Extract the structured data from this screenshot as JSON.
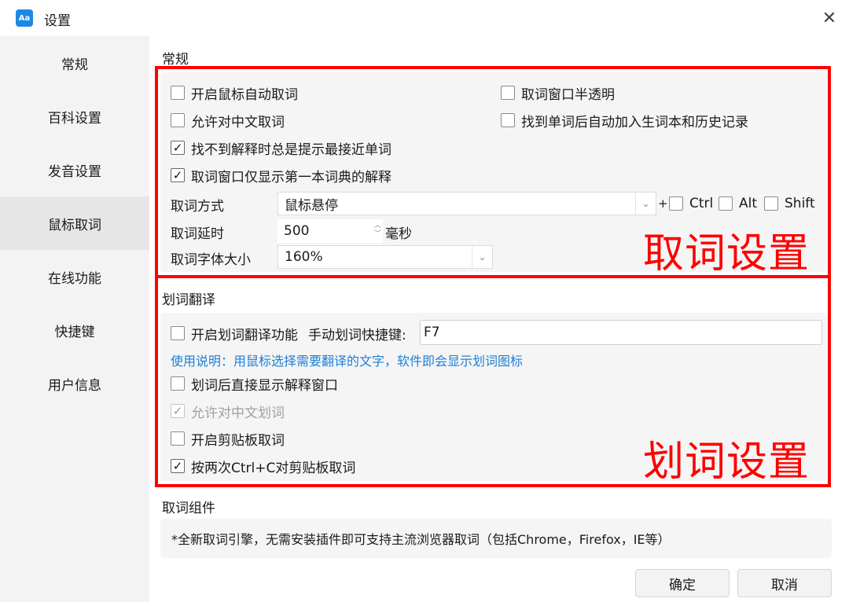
{
  "window": {
    "title": "设置",
    "icon_text": "Aa"
  },
  "sidebar": {
    "items": [
      {
        "label": "常规"
      },
      {
        "label": "百科设置"
      },
      {
        "label": "发音设置"
      },
      {
        "label": "鼠标取词",
        "active": true
      },
      {
        "label": "在线功能"
      },
      {
        "label": "快捷键"
      },
      {
        "label": "用户信息"
      }
    ]
  },
  "general": {
    "section_title": "常规",
    "options": {
      "mouse_auto": {
        "label": "开启鼠标自动取词",
        "checked": false
      },
      "semi_transparent": {
        "label": "取词窗口半透明",
        "checked": false
      },
      "allow_chinese": {
        "label": "允许对中文取词",
        "checked": false
      },
      "auto_add_history": {
        "label": "找到单词后自动加入生词本和历史记录",
        "checked": false
      },
      "suggest_nearest": {
        "label": "找不到解释时总是提示最接近单词",
        "checked": true
      },
      "first_dict_only": {
        "label": "取词窗口仅显示第一本词典的解释",
        "checked": true
      }
    },
    "mode": {
      "label": "取词方式",
      "value": "鼠标悬停",
      "plus": "+"
    },
    "modifiers": [
      {
        "label": "Ctrl",
        "checked": false
      },
      {
        "label": "Alt",
        "checked": false
      },
      {
        "label": "Shift",
        "checked": false
      }
    ],
    "delay": {
      "label": "取词延时",
      "value": "500",
      "unit": "毫秒"
    },
    "font_size": {
      "label": "取词字体大小",
      "value": "160%"
    },
    "annotation": "取词设置"
  },
  "selection": {
    "section_title": "划词翻译",
    "enable": {
      "label": "开启划词翻译功能",
      "checked": false
    },
    "hotkey": {
      "label": "手动划词快捷键:",
      "value": "F7"
    },
    "usage_hint": "使用说明：用鼠标选择需要翻译的文字，软件即会显示划词图标",
    "show_window": {
      "label": "划词后直接显示解释窗口",
      "checked": false
    },
    "allow_chinese": {
      "label": "允许对中文划词",
      "checked": true,
      "disabled": true
    },
    "clipboard": {
      "label": "开启剪贴板取词",
      "checked": false
    },
    "double_ctrl_c": {
      "label": "按两次Ctrl+C对剪贴板取词",
      "checked": true
    },
    "annotation": "划词设置"
  },
  "component": {
    "section_title": "取词组件",
    "note": "*全新取词引擎，无需安装插件即可支持主流浏览器取词（包括Chrome，Firefox，IE等）"
  },
  "buttons": {
    "ok": "确定",
    "cancel": "取消"
  },
  "colors": {
    "annotation_red": "#ff0000",
    "link_blue": "#1c7fd6",
    "app_icon_blue": "#1e88e5"
  },
  "icons": {
    "close": "close-icon",
    "app": "app-logo-icon",
    "chevron": "chevron-down-icon",
    "check": "check-icon"
  }
}
